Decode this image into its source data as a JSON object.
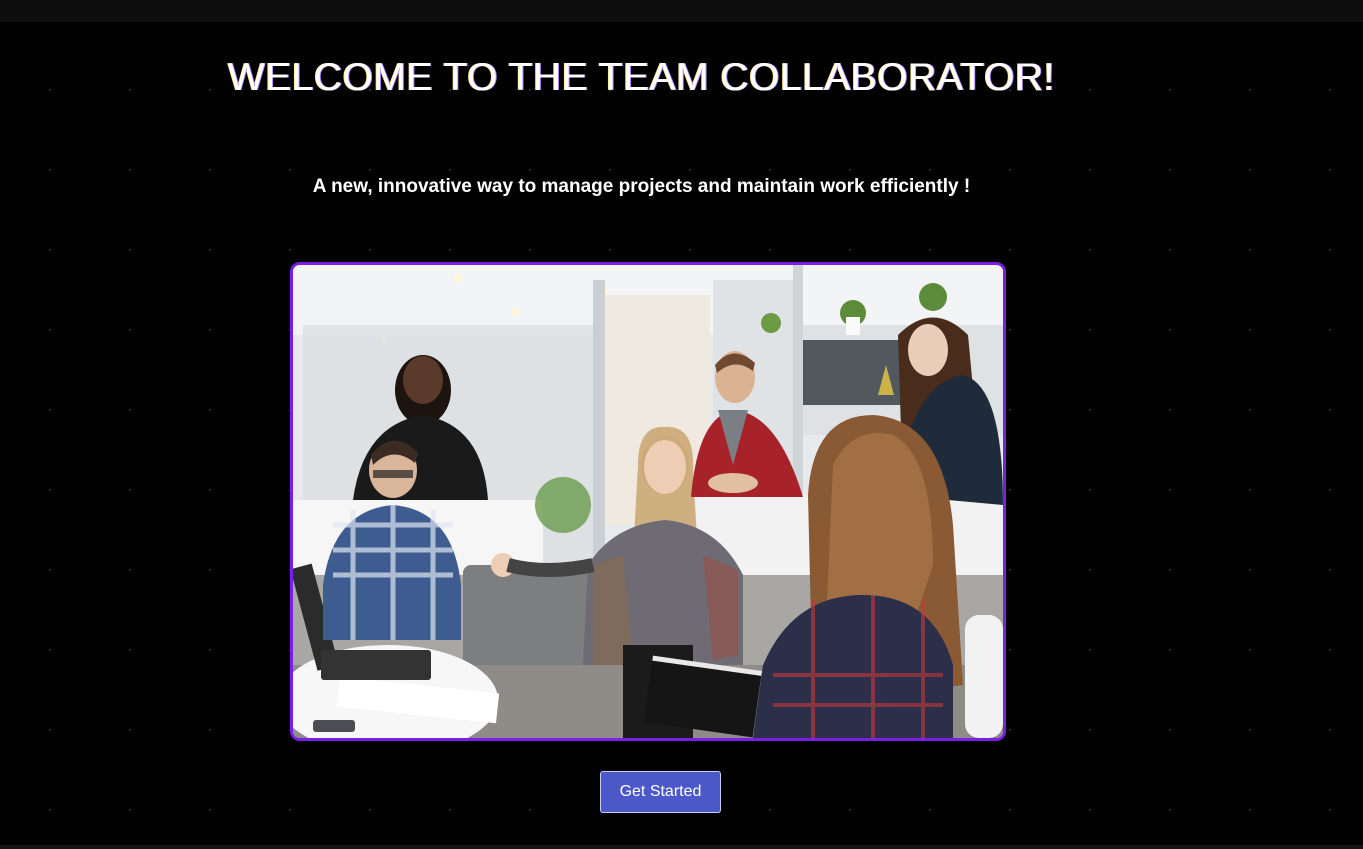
{
  "hero": {
    "title": "WELCOME TO THE TEAM COLLABORATOR!",
    "subtitle": "A new, innovative way to manage projects and maintain work efficiently !"
  },
  "image": {
    "alt": "A team meeting in a bright office with people discussing around a table with a laptop"
  },
  "cta": {
    "label": "Get Started"
  },
  "colors": {
    "background": "#020202",
    "frame_border": "#7b1fe8",
    "button": "#4c57c8"
  }
}
